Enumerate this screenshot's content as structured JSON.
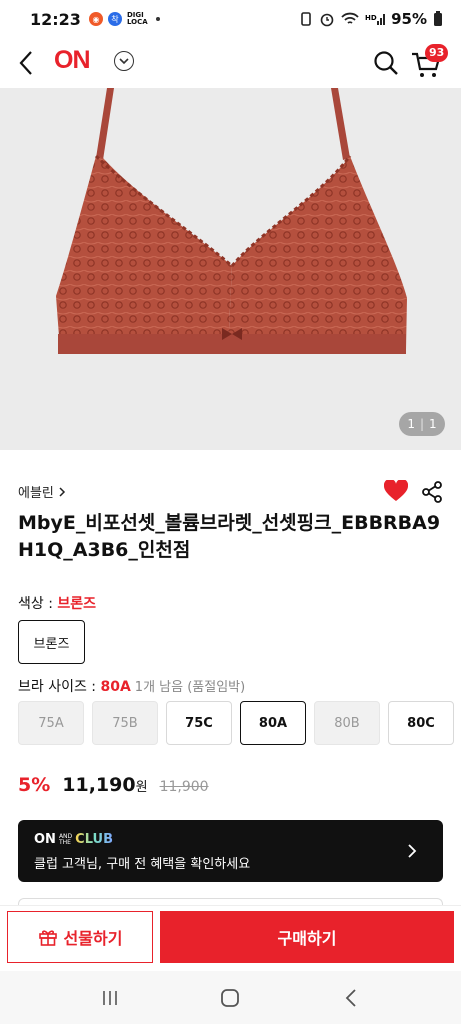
{
  "status_bar": {
    "time": "12:23",
    "app_digi": "DIGI",
    "app_loca": "LOCA",
    "battery": "95%"
  },
  "header": {
    "logo": "ON",
    "cart_count": "93"
  },
  "gallery": {
    "current": "1",
    "total": "1"
  },
  "product": {
    "brand": "에블린",
    "title": "MbyE_비포선셋_볼륨브라렛_선셋핑크_EBBRBA9H1Q_A3B6_인천점"
  },
  "color_option": {
    "label": "색상 : ",
    "selected": "브론즈",
    "chip": "브론즈"
  },
  "size_option": {
    "label": "브라 사이즈 : ",
    "selected": "80A",
    "stock": "1개 남음 (품절임박)",
    "sizes": [
      {
        "label": "75A",
        "state": "off"
      },
      {
        "label": "75B",
        "state": "off"
      },
      {
        "label": "75C",
        "state": "on"
      },
      {
        "label": "80A",
        "state": "selected"
      },
      {
        "label": "80B",
        "state": "off"
      },
      {
        "label": "80C",
        "state": "on"
      }
    ]
  },
  "price": {
    "discount": "5%",
    "sale": "11,190",
    "unit": "원",
    "original": "11,900"
  },
  "club": {
    "on": "ON",
    "and": "AND",
    "the": "THE",
    "club": "CLUB",
    "text": "클럽 고객님, 구매 전 혜택을 확인하세요"
  },
  "actions": {
    "gift": "선물하기",
    "buy": "구매하기"
  },
  "colors": {
    "accent": "#e8222b",
    "product": "#b5503e"
  }
}
